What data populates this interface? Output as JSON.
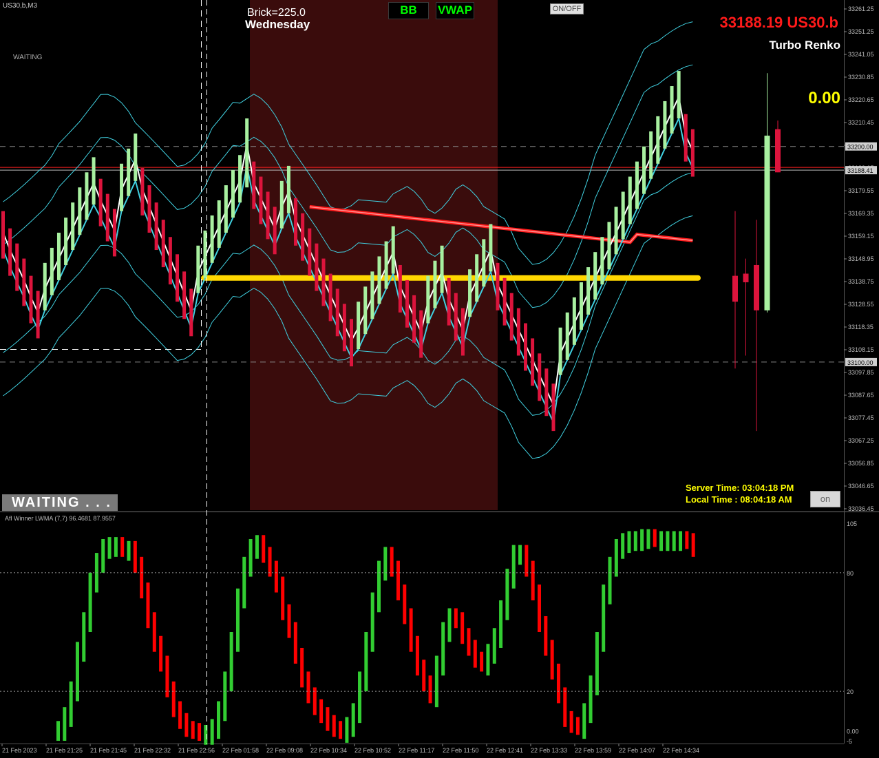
{
  "chart_header": "US30,b,M3",
  "waiting_small": "WAITING",
  "waiting_big": "WAITING . . .",
  "brick": "Brick=225.0",
  "day": "Wednesday",
  "buttons": {
    "bb": "BB",
    "vwap": "VWAP",
    "onoff": "ON/OFF",
    "on": "on"
  },
  "price_display": "33188.19 US30.b",
  "chart_type": "Turbo Renko",
  "profit": "0.00",
  "server_time": "Server Time: 03:04:18 PM",
  "local_time": "Local Time  : 08:04:18 AM",
  "indicator_label": "Afl Winner LWMA (7,7) 96.4681 87.9557",
  "colors": {
    "bull": "#a8f0a0",
    "bear": "#dc143c",
    "band": "#40d0e0",
    "vwap": "#ff1a1a",
    "level": "#ffd700",
    "session": "#3a0c0c",
    "osc_up": "#32cd32",
    "osc_dn": "#ff0000"
  },
  "chart_data": [
    {
      "type": "renko-candlestick",
      "price_axis_ticks": [
        "33261.25",
        "33251.25",
        "33241.05",
        "33230.85",
        "33220.65",
        "33210.45",
        "33200.25",
        "33189.05",
        "33179.55",
        "33169.35",
        "33159.15",
        "33148.95",
        "33138.75",
        "33128.55",
        "33118.35",
        "33108.15",
        "33097.85",
        "33087.65",
        "33077.45",
        "33067.25",
        "33056.85",
        "33046.65",
        "33036.45"
      ],
      "price_labels": [
        "33200.00",
        "33188.41",
        "33100.00"
      ],
      "ylim": [
        33031,
        33266
      ],
      "levels": [
        33200,
        33189,
        33100
      ],
      "yellow_level": 33139,
      "renko_bricks": [
        {
          "dir": -1,
          "o": 33170,
          "c": 33148
        },
        {
          "dir": -1,
          "o": 33162,
          "c": 33140
        },
        {
          "dir": -1,
          "o": 33155,
          "c": 33133
        },
        {
          "dir": -1,
          "o": 33148,
          "c": 33126
        },
        {
          "dir": -1,
          "o": 33140,
          "c": 33118
        },
        {
          "dir": -1,
          "o": 33133,
          "c": 33111
        },
        {
          "dir": 1,
          "o": 33124,
          "c": 33146
        },
        {
          "dir": 1,
          "o": 33131,
          "c": 33153
        },
        {
          "dir": 1,
          "o": 33138,
          "c": 33160
        },
        {
          "dir": 1,
          "o": 33145,
          "c": 33167
        },
        {
          "dir": 1,
          "o": 33152,
          "c": 33174
        },
        {
          "dir": 1,
          "o": 33159,
          "c": 33181
        },
        {
          "dir": 1,
          "o": 33166,
          "c": 33188
        },
        {
          "dir": 1,
          "o": 33173,
          "c": 33195
        },
        {
          "dir": -1,
          "o": 33185,
          "c": 33163
        },
        {
          "dir": -1,
          "o": 33178,
          "c": 33156
        },
        {
          "dir": -1,
          "o": 33171,
          "c": 33149
        },
        {
          "dir": 1,
          "o": 33170,
          "c": 33192
        },
        {
          "dir": 1,
          "o": 33177,
          "c": 33199
        },
        {
          "dir": 1,
          "o": 33184,
          "c": 33206
        },
        {
          "dir": -1,
          "o": 33190,
          "c": 33168
        },
        {
          "dir": -1,
          "o": 33182,
          "c": 33160
        },
        {
          "dir": -1,
          "o": 33174,
          "c": 33152
        },
        {
          "dir": -1,
          "o": 33166,
          "c": 33144
        },
        {
          "dir": -1,
          "o": 33158,
          "c": 33136
        },
        {
          "dir": -1,
          "o": 33150,
          "c": 33128
        },
        {
          "dir": -1,
          "o": 33142,
          "c": 33120
        },
        {
          "dir": -1,
          "o": 33134,
          "c": 33112
        },
        {
          "dir": 1,
          "o": 33132,
          "c": 33154
        },
        {
          "dir": 1,
          "o": 33139,
          "c": 33161
        },
        {
          "dir": 1,
          "o": 33146,
          "c": 33168
        },
        {
          "dir": 1,
          "o": 33153,
          "c": 33175
        },
        {
          "dir": 1,
          "o": 33160,
          "c": 33182
        },
        {
          "dir": 1,
          "o": 33167,
          "c": 33189
        },
        {
          "dir": 1,
          "o": 33174,
          "c": 33196
        },
        {
          "dir": 1,
          "o": 33181,
          "c": 33213
        },
        {
          "dir": -1,
          "o": 33193,
          "c": 33171
        },
        {
          "dir": -1,
          "o": 33186,
          "c": 33164
        },
        {
          "dir": -1,
          "o": 33179,
          "c": 33157
        },
        {
          "dir": -1,
          "o": 33172,
          "c": 33150
        },
        {
          "dir": 1,
          "o": 33162,
          "c": 33184
        },
        {
          "dir": 1,
          "o": 33169,
          "c": 33191
        },
        {
          "dir": -1,
          "o": 33176,
          "c": 33154
        },
        {
          "dir": -1,
          "o": 33169,
          "c": 33147
        },
        {
          "dir": -1,
          "o": 33162,
          "c": 33140
        },
        {
          "dir": -1,
          "o": 33155,
          "c": 33133
        },
        {
          "dir": -1,
          "o": 33148,
          "c": 33126
        },
        {
          "dir": -1,
          "o": 33141,
          "c": 33119
        },
        {
          "dir": -1,
          "o": 33134,
          "c": 33112
        },
        {
          "dir": -1,
          "o": 33127,
          "c": 33105
        },
        {
          "dir": -1,
          "o": 33120,
          "c": 33098
        },
        {
          "dir": 1,
          "o": 33106,
          "c": 33128
        },
        {
          "dir": 1,
          "o": 33113,
          "c": 33135
        },
        {
          "dir": 1,
          "o": 33120,
          "c": 33142
        },
        {
          "dir": 1,
          "o": 33127,
          "c": 33149
        },
        {
          "dir": 1,
          "o": 33134,
          "c": 33156
        },
        {
          "dir": 1,
          "o": 33141,
          "c": 33163
        },
        {
          "dir": -1,
          "o": 33145,
          "c": 33123
        },
        {
          "dir": -1,
          "o": 33138,
          "c": 33116
        },
        {
          "dir": -1,
          "o": 33131,
          "c": 33109
        },
        {
          "dir": -1,
          "o": 33124,
          "c": 33102
        },
        {
          "dir": 1,
          "o": 33118,
          "c": 33140
        },
        {
          "dir": 1,
          "o": 33125,
          "c": 33147
        },
        {
          "dir": 1,
          "o": 33132,
          "c": 33154
        },
        {
          "dir": -1,
          "o": 33139,
          "c": 33117
        },
        {
          "dir": -1,
          "o": 33132,
          "c": 33110
        },
        {
          "dir": -1,
          "o": 33125,
          "c": 33103
        },
        {
          "dir": 1,
          "o": 33121,
          "c": 33143
        },
        {
          "dir": 1,
          "o": 33128,
          "c": 33150
        },
        {
          "dir": 1,
          "o": 33135,
          "c": 33157
        },
        {
          "dir": 1,
          "o": 33142,
          "c": 33164
        },
        {
          "dir": -1,
          "o": 33146,
          "c": 33124
        },
        {
          "dir": -1,
          "o": 33139,
          "c": 33117
        },
        {
          "dir": -1,
          "o": 33132,
          "c": 33110
        },
        {
          "dir": -1,
          "o": 33125,
          "c": 33103
        },
        {
          "dir": -1,
          "o": 33118,
          "c": 33096
        },
        {
          "dir": -1,
          "o": 33111,
          "c": 33089
        },
        {
          "dir": -1,
          "o": 33104,
          "c": 33082
        },
        {
          "dir": -1,
          "o": 33097,
          "c": 33075
        },
        {
          "dir": -1,
          "o": 33090,
          "c": 33068
        },
        {
          "dir": 1,
          "o": 33094,
          "c": 33116
        },
        {
          "dir": 1,
          "o": 33101,
          "c": 33123
        },
        {
          "dir": 1,
          "o": 33108,
          "c": 33130
        },
        {
          "dir": 1,
          "o": 33115,
          "c": 33137
        },
        {
          "dir": 1,
          "o": 33122,
          "c": 33144
        },
        {
          "dir": 1,
          "o": 33129,
          "c": 33151
        },
        {
          "dir": 1,
          "o": 33136,
          "c": 33158
        },
        {
          "dir": 1,
          "o": 33143,
          "c": 33165
        },
        {
          "dir": 1,
          "o": 33150,
          "c": 33172
        },
        {
          "dir": 1,
          "o": 33157,
          "c": 33179
        },
        {
          "dir": 1,
          "o": 33164,
          "c": 33186
        },
        {
          "dir": 1,
          "o": 33171,
          "c": 33193
        },
        {
          "dir": 1,
          "o": 33178,
          "c": 33200
        },
        {
          "dir": 1,
          "o": 33185,
          "c": 33207
        },
        {
          "dir": 1,
          "o": 33192,
          "c": 33214
        },
        {
          "dir": 1,
          "o": 33199,
          "c": 33221
        },
        {
          "dir": 1,
          "o": 33206,
          "c": 33228
        },
        {
          "dir": 1,
          "o": 33213,
          "c": 33235
        },
        {
          "dir": -1,
          "o": 33215,
          "c": 33193
        },
        {
          "dir": -1,
          "o": 33208,
          "c": 33186
        }
      ],
      "candles": [
        {
          "o": 33140,
          "c": 33128,
          "h": 33170,
          "l": 33097
        },
        {
          "o": 33141,
          "c": 33137,
          "h": 33148,
          "l": 33103
        },
        {
          "o": 33145,
          "c": 33124,
          "h": 33166,
          "l": 33068
        },
        {
          "o": 33124,
          "c": 33205,
          "h": 33234,
          "l": 33123
        },
        {
          "o": 33208,
          "c": 33188,
          "h": 33212,
          "l": 33188
        }
      ],
      "x_labels": [
        "21 Feb 2023",
        "21 Feb 21:25",
        "21 Feb 21:45",
        "21 Feb 22:32",
        "21 Feb 22:56",
        "22 Feb 01:58",
        "22 Feb 09:08",
        "22 Feb 10:34",
        "22 Feb 10:52",
        "22 Feb 11:17",
        "22 Feb 11:50",
        "22 Feb 12:41",
        "22 Feb 13:33",
        "22 Feb 13:59",
        "22 Feb 14:07",
        "22 Feb 14:34"
      ]
    },
    {
      "type": "bar",
      "title": "Afl Winner LWMA (7,7) 96.4681 87.9557",
      "axis_ticks": [
        "105",
        "80",
        "20",
        "0.00",
        "-5"
      ],
      "ylim": [
        -5,
        105
      ],
      "levels": [
        80,
        20
      ],
      "values": [
        5,
        12,
        25,
        45,
        60,
        80,
        90,
        97,
        98,
        98,
        96,
        96,
        88,
        75,
        60,
        48,
        38,
        25,
        15,
        9,
        5,
        4,
        3,
        3,
        6,
        15,
        30,
        50,
        72,
        88,
        97,
        99,
        93,
        86,
        78,
        64,
        55,
        42,
        30,
        22,
        16,
        12,
        8,
        5,
        4,
        7,
        14,
        30,
        50,
        70,
        86,
        93,
        86,
        74,
        62,
        48,
        36,
        28,
        22,
        38,
        55,
        62,
        60,
        52,
        46,
        40,
        38,
        44,
        52,
        66,
        82,
        94,
        94,
        86,
        74,
        58,
        46,
        34,
        22,
        10,
        7,
        6,
        14,
        28,
        50,
        74,
        88,
        97,
        100,
        101,
        101,
        102,
        102,
        101,
        101,
        101,
        101,
        101,
        100,
        96
      ]
    }
  ]
}
